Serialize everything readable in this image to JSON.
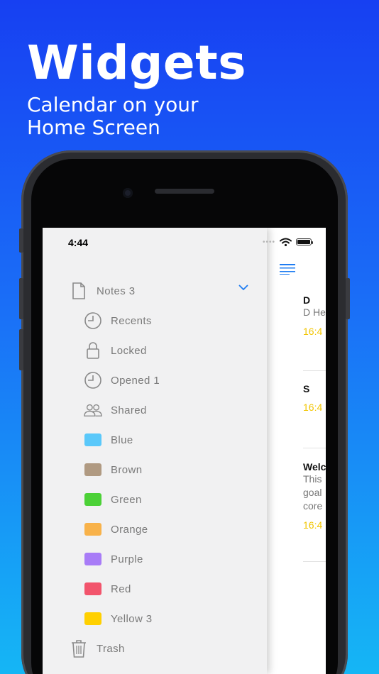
{
  "promo": {
    "title": "Widgets",
    "subtitle": "Calendar on your Home Screen"
  },
  "status_bar": {
    "time": "4:44"
  },
  "sidebar": {
    "notebook": {
      "label": "Notes 3",
      "icon": "document-icon"
    },
    "items": [
      {
        "label": "Recents",
        "icon": "clock-icon"
      },
      {
        "label": "Locked",
        "icon": "lock-icon"
      },
      {
        "label": "Opened 1",
        "icon": "clock-icon"
      },
      {
        "label": "Shared",
        "icon": "people-icon"
      },
      {
        "label": "Blue",
        "color": "#5ac8fa"
      },
      {
        "label": "Brown",
        "color": "#b09a82"
      },
      {
        "label": "Green",
        "color": "#4cd137"
      },
      {
        "label": "Orange",
        "color": "#f8b24a"
      },
      {
        "label": "Purple",
        "color": "#a87cf7"
      },
      {
        "label": "Red",
        "color": "#f2546c"
      },
      {
        "label": "Yellow 3",
        "color": "#ffd000"
      }
    ],
    "trash": {
      "label": "Trash",
      "icon": "trash-icon"
    }
  },
  "notes": [
    {
      "title": "D",
      "body": [
        "D He"
      ],
      "time": "16:4"
    },
    {
      "title": "S",
      "body": [],
      "time": "16:4"
    },
    {
      "title": "Welc",
      "body": [
        "This",
        "goal",
        "core"
      ],
      "time": "16:4"
    }
  ],
  "colors": {
    "accent": "#1e7cf2",
    "note_time": "#f2c500",
    "sidebar_bg": "#f1f1f2"
  }
}
